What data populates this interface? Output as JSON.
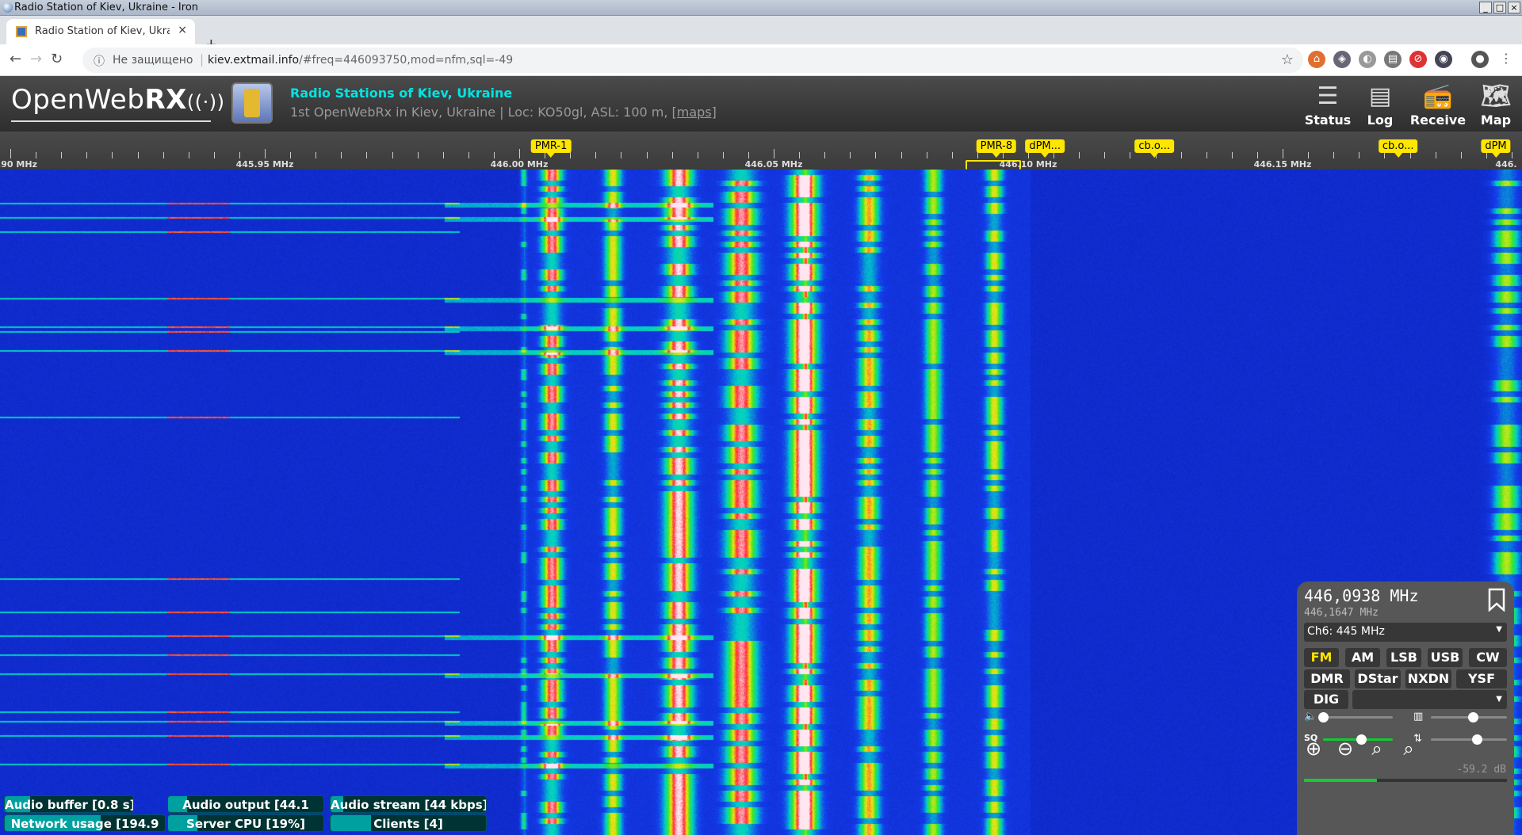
{
  "window": {
    "title": "Radio Station of Kiev, Ukraine - Iron"
  },
  "tab": {
    "title": "Radio Station of Kiev, Ukra",
    "close": "×",
    "new_tab": "+"
  },
  "address_bar": {
    "security_label": "Не защищено",
    "host": "kiev.extmail.info",
    "path": "/#freq=446093750,mod=nfm,sql=-49"
  },
  "header": {
    "logo_light": "OpenWeb",
    "logo_bold": "RX",
    "logo_signal": "((·))",
    "site_title": "Radio Stations of Kiev, Ukraine",
    "site_description": "1st OpenWebRx in Kiev, Ukraine | Loc: KO50gl, ASL: 100 m, ",
    "maps_link": "[maps]",
    "nav": [
      {
        "label": "Status",
        "icon": "status-icon"
      },
      {
        "label": "Log",
        "icon": "log-icon"
      },
      {
        "label": "Receive",
        "icon": "receive-icon"
      },
      {
        "label": "Map",
        "icon": "map-icon"
      }
    ]
  },
  "scale": {
    "labels": [
      {
        "text": ".90 MHz",
        "freq": 445.9
      },
      {
        "text": "445.95 MHz",
        "freq": 445.95
      },
      {
        "text": "446.00 MHz",
        "freq": 446.0
      },
      {
        "text": "446.05 MHz",
        "freq": 446.05
      },
      {
        "text": "446.10 MHz",
        "freq": 446.1
      },
      {
        "text": "446.15 MHz",
        "freq": 446.15
      },
      {
        "text": "446.",
        "freq": 446.2
      }
    ],
    "bookmarks": [
      {
        "text": "PMR-1",
        "freq": 446.00625
      },
      {
        "text": "PMR-8",
        "freq": 446.09375
      },
      {
        "text": "dPM...",
        "freq": 446.1033
      },
      {
        "text": "cb.o...",
        "freq": 446.1248
      },
      {
        "text": "cb.o...",
        "freq": 446.1727
      },
      {
        "text": "dPM",
        "freq": 446.1919
      }
    ]
  },
  "status_bars": [
    {
      "label": "Audio buffer [0.8 s]",
      "fill": 0.2
    },
    {
      "label": "Audio output [44.1",
      "fill": 0.12
    },
    {
      "label": "Audio stream [44 kbps]",
      "fill": 0.08
    },
    {
      "label": "Network usage [194.9",
      "fill": 0.6
    },
    {
      "label": "Server CPU [19%]",
      "fill": 0.19
    },
    {
      "label": "Clients [4]",
      "fill": 0.26
    }
  ],
  "receiver": {
    "frequency": "446,0938 MHz",
    "frequency_secondary": "446,1647 MHz",
    "preset": "Ch6: 445 MHz",
    "modes_row1": [
      "FM",
      "AM",
      "LSB",
      "USB",
      "CW"
    ],
    "modes_row2": [
      "DMR",
      "DStar",
      "NXDN",
      "YSF"
    ],
    "dig_label": "DIG",
    "active_mode": "FM",
    "squelch_label": "SQ",
    "volume_level": 0.0,
    "nr_level": 0.55,
    "squelch_level": 0.55,
    "agc_level": 0.6,
    "db_reading": "-59.2 dB",
    "signal_level": 0.36
  },
  "colors": {
    "accent": "#00e4e4",
    "bookmark": "#ffe600",
    "status_fill": "#00a0a0"
  }
}
